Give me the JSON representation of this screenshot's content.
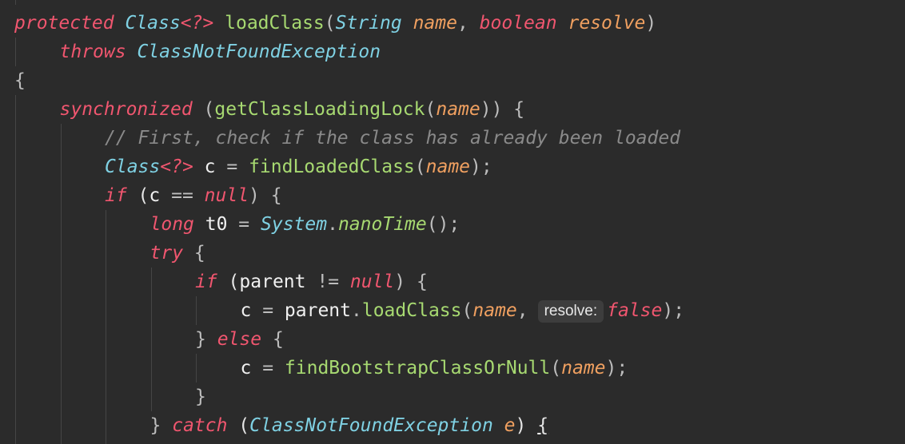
{
  "editor": {
    "lines": [
      {
        "indent": 0,
        "tokens": [
          {
            "t": "protected",
            "c": "kw"
          },
          {
            "t": " "
          },
          {
            "t": "Class",
            "c": "type"
          },
          {
            "t": "<?>",
            "c": "kw"
          },
          {
            "t": " "
          },
          {
            "t": "loadClass",
            "c": "fn"
          },
          {
            "t": "(",
            "c": "pun"
          },
          {
            "t": "String",
            "c": "type"
          },
          {
            "t": " "
          },
          {
            "t": "name",
            "c": "par"
          },
          {
            "t": ", ",
            "c": "pun"
          },
          {
            "t": "boolean",
            "c": "kw"
          },
          {
            "t": " "
          },
          {
            "t": "resolve",
            "c": "par"
          },
          {
            "t": ")",
            "c": "pun"
          }
        ]
      },
      {
        "indent": 1,
        "tokens": [
          {
            "t": "throws",
            "c": "kw"
          },
          {
            "t": " "
          },
          {
            "t": "ClassNotFoundException",
            "c": "type"
          }
        ]
      },
      {
        "indent": 0,
        "tokens": [
          {
            "t": "{",
            "c": "pun"
          }
        ]
      },
      {
        "indent": 1,
        "tokens": [
          {
            "t": "synchronized",
            "c": "kw"
          },
          {
            "t": " "
          },
          {
            "t": "(",
            "c": "pun"
          },
          {
            "t": "getClassLoadingLock",
            "c": "fn"
          },
          {
            "t": "(",
            "c": "pun"
          },
          {
            "t": "name",
            "c": "par"
          },
          {
            "t": ")) {",
            "c": "pun"
          }
        ]
      },
      {
        "indent": 2,
        "tokens": [
          {
            "t": "// First, check if the class has already been loaded",
            "c": "cmt"
          }
        ]
      },
      {
        "indent": 2,
        "tokens": [
          {
            "t": "Class",
            "c": "type"
          },
          {
            "t": "<?>",
            "c": "kw"
          },
          {
            "t": " "
          },
          {
            "t": "c",
            "c": "var"
          },
          {
            "t": " = ",
            "c": "pun"
          },
          {
            "t": "findLoadedClass",
            "c": "fn"
          },
          {
            "t": "(",
            "c": "pun"
          },
          {
            "t": "name",
            "c": "par"
          },
          {
            "t": ");",
            "c": "pun"
          }
        ]
      },
      {
        "indent": 2,
        "tokens": [
          {
            "t": "if",
            "c": "kw"
          },
          {
            "t": " ("
          },
          {
            "t": "c",
            "c": "var"
          },
          {
            "t": " == ",
            "c": "pun"
          },
          {
            "t": "null",
            "c": "kw"
          },
          {
            "t": ") {",
            "c": "pun"
          }
        ]
      },
      {
        "indent": 3,
        "tokens": [
          {
            "t": "long",
            "c": "kw"
          },
          {
            "t": " "
          },
          {
            "t": "t0",
            "c": "var"
          },
          {
            "t": " = ",
            "c": "pun"
          },
          {
            "t": "System",
            "c": "type"
          },
          {
            "t": ".",
            "c": "pun"
          },
          {
            "t": "nanoTime",
            "c": "fni"
          },
          {
            "t": "();",
            "c": "pun"
          }
        ]
      },
      {
        "indent": 3,
        "tokens": [
          {
            "t": "try",
            "c": "kw"
          },
          {
            "t": " {",
            "c": "pun"
          }
        ]
      },
      {
        "indent": 4,
        "tokens": [
          {
            "t": "if",
            "c": "kw"
          },
          {
            "t": " ("
          },
          {
            "t": "parent",
            "c": "var"
          },
          {
            "t": " != ",
            "c": "pun"
          },
          {
            "t": "null",
            "c": "kw"
          },
          {
            "t": ") {",
            "c": "pun"
          }
        ]
      },
      {
        "indent": 5,
        "tokens": [
          {
            "t": "c",
            "c": "var"
          },
          {
            "t": " = ",
            "c": "pun"
          },
          {
            "t": "parent",
            "c": "var"
          },
          {
            "t": ".",
            "c": "pun"
          },
          {
            "t": "loadClass",
            "c": "fn"
          },
          {
            "t": "(",
            "c": "pun"
          },
          {
            "t": "name",
            "c": "par"
          },
          {
            "t": ",",
            "c": "pun"
          },
          {
            "t": "resolve:",
            "c": "hint"
          },
          {
            "t": "false",
            "c": "kw"
          },
          {
            "t": ");",
            "c": "pun"
          }
        ]
      },
      {
        "indent": 4,
        "tokens": [
          {
            "t": "} ",
            "c": "pun"
          },
          {
            "t": "else",
            "c": "kw"
          },
          {
            "t": " {",
            "c": "pun"
          }
        ]
      },
      {
        "indent": 5,
        "tokens": [
          {
            "t": "c",
            "c": "var"
          },
          {
            "t": " = ",
            "c": "pun"
          },
          {
            "t": "findBootstrapClassOrNull",
            "c": "fn"
          },
          {
            "t": "(",
            "c": "pun"
          },
          {
            "t": "name",
            "c": "par"
          },
          {
            "t": ");",
            "c": "pun"
          }
        ]
      },
      {
        "indent": 4,
        "tokens": [
          {
            "t": "}",
            "c": "pun"
          }
        ]
      },
      {
        "indent": 3,
        "tokens": [
          {
            "t": "} ",
            "c": "pun"
          },
          {
            "t": "catch",
            "c": "kw"
          },
          {
            "t": " ("
          },
          {
            "t": "ClassNotFoundException",
            "c": "type"
          },
          {
            "t": " "
          },
          {
            "t": "e",
            "c": "par"
          },
          {
            "t": ") "
          },
          {
            "t": "{",
            "c": "cursor"
          }
        ]
      }
    ],
    "colors": {
      "background": "#2b2b2b",
      "keyword": "#f0566f",
      "type": "#7fd1e3",
      "function": "#a7d971",
      "parameter": "#f0a060",
      "comment": "#8a8a8a"
    }
  }
}
